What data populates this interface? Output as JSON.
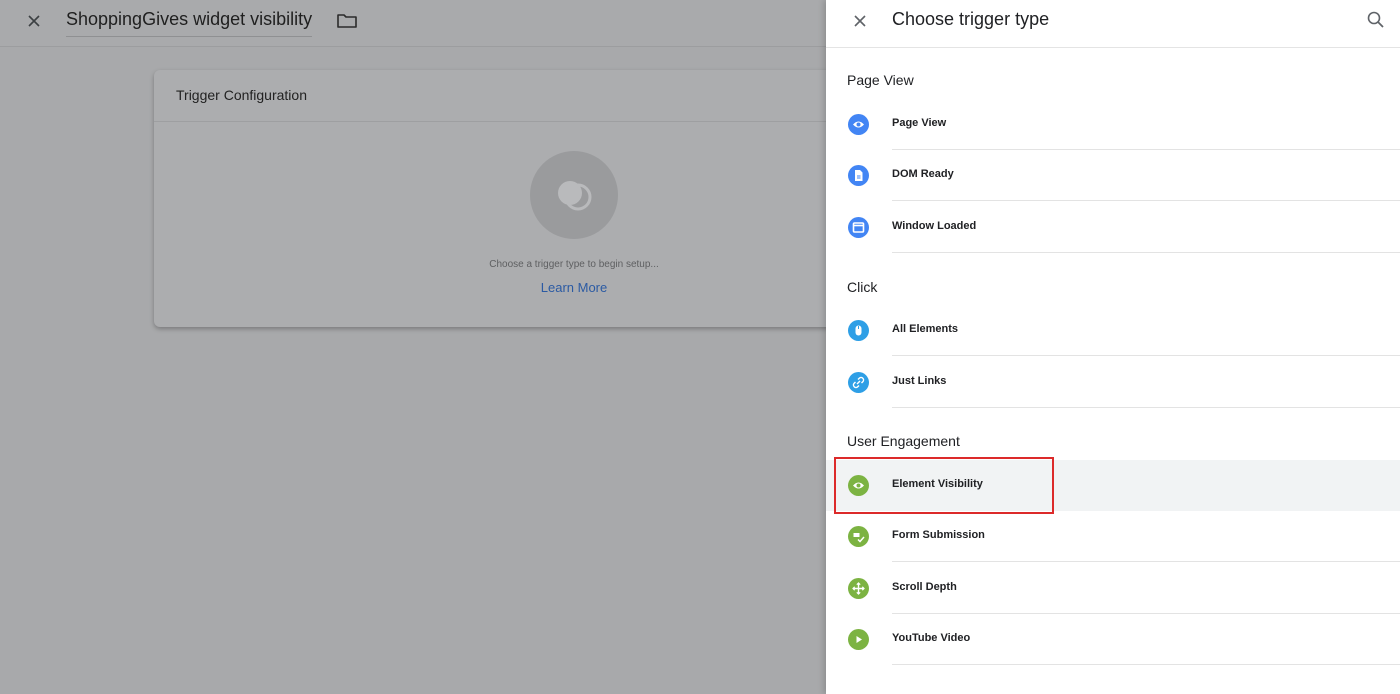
{
  "editor": {
    "title": "ShoppingGives widget visibility",
    "config_card": {
      "title": "Trigger Configuration",
      "placeholder": "Choose a trigger type to begin setup...",
      "learn_more": "Learn More"
    }
  },
  "drawer": {
    "title": "Choose trigger type",
    "sections": [
      {
        "heading": "Page View",
        "items": [
          {
            "label": "Page View",
            "icon": "eye-icon",
            "color": "#4285f4"
          },
          {
            "label": "DOM Ready",
            "icon": "document-icon",
            "color": "#4285f4"
          },
          {
            "label": "Window Loaded",
            "icon": "window-icon",
            "color": "#4285f4"
          }
        ]
      },
      {
        "heading": "Click",
        "items": [
          {
            "label": "All Elements",
            "icon": "mouse-icon",
            "color": "#2e9fe6"
          },
          {
            "label": "Just Links",
            "icon": "link-icon",
            "color": "#2e9fe6"
          }
        ]
      },
      {
        "heading": "User Engagement",
        "items": [
          {
            "label": "Element Visibility",
            "icon": "eye-icon",
            "color": "#7cb342",
            "highlighted": true
          },
          {
            "label": "Form Submission",
            "icon": "form-icon",
            "color": "#7cb342"
          },
          {
            "label": "Scroll Depth",
            "icon": "scroll-icon",
            "color": "#7cb342"
          },
          {
            "label": "YouTube Video",
            "icon": "play-icon",
            "color": "#7cb342"
          }
        ]
      }
    ]
  },
  "colors": {
    "overlay": "#a8a9ab",
    "highlight_border": "#dc2a2a",
    "link": "#2b5aa3"
  }
}
